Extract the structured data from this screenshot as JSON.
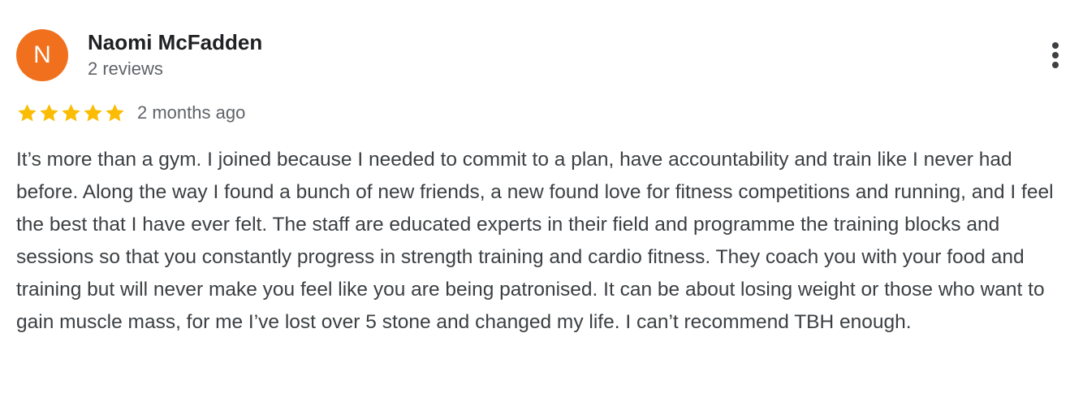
{
  "review": {
    "avatar_initial": "N",
    "avatar_color": "#f0701d",
    "reviewer_name": "Naomi McFadden",
    "review_count": "2 reviews",
    "rating": 5,
    "rating_max": 5,
    "star_color": "#fbbc04",
    "time_ago": "2 months ago",
    "text": "It’s more than a gym. I joined because I needed to commit to a plan, have accountability and train like I never had before. Along the way I found a bunch of new friends, a new found love for fitness competitions and running, and I feel the best that I have ever felt. The staff are educated experts in their field and programme the training blocks and sessions so that you constantly progress in strength training and cardio fitness. They coach you with your food and training but will never make you feel like you are being patronised. It can be about losing weight or those who want to gain muscle mass, for me I’ve lost over 5 stone and changed my life. I can’t recommend TBH enough."
  },
  "icons": {
    "more": "more-vertical-icon",
    "star": "star-icon"
  }
}
